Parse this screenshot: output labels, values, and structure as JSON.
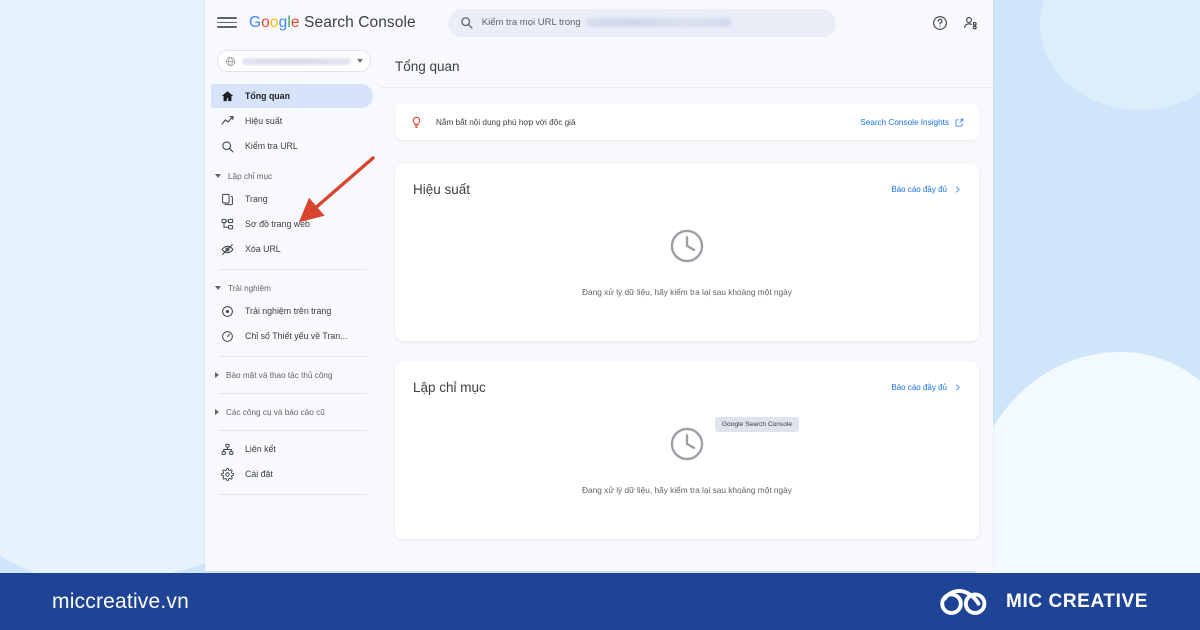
{
  "background": {
    "page_bg_color": "#cfe6fa",
    "blob_color": "#e6f3fd"
  },
  "window": {
    "topbar": {
      "menu_icon": "hamburger-icon",
      "brand": {
        "google": "Google",
        "product": "Search Console"
      },
      "search": {
        "icon": "search-icon",
        "placeholder": "Kiểm tra mọi URL trong",
        "redacted_value": ""
      },
      "help_icon": "help-circle-icon",
      "account_icon": "account-person-icon"
    },
    "sidebar": {
      "property_selector": {
        "icon": "globe-icon",
        "value": "",
        "caret_icon": "chevron-down-icon"
      },
      "items": [
        {
          "label": "Tổng quan",
          "icon": "home-icon",
          "active": true
        },
        {
          "label": "Hiệu suất",
          "icon": "performance-trend-icon",
          "active": false
        },
        {
          "label": "Kiểm tra URL",
          "icon": "search-icon",
          "active": false
        }
      ],
      "sections": [
        {
          "label": "Lập chỉ mục",
          "expanded": true,
          "items": [
            {
              "label": "Trang",
              "icon": "pages-icon"
            },
            {
              "label": "Sơ đồ trang web",
              "icon": "sitemap-icon"
            },
            {
              "label": "Xóa URL",
              "icon": "removals-eye-slash-icon"
            }
          ]
        },
        {
          "label": "Trải nghiệm",
          "expanded": true,
          "items": [
            {
              "label": "Trải nghiệm trên trang",
              "icon": "page-experience-icon"
            },
            {
              "label": "Chỉ số Thiết yếu về Tran...",
              "icon": "core-web-vitals-icon"
            }
          ]
        },
        {
          "label": "Bảo mật và thao tác thủ công",
          "expanded": false,
          "items": []
        },
        {
          "label": "Các công cụ và báo cáo cũ",
          "expanded": false,
          "items": []
        }
      ],
      "footer_items": [
        {
          "label": "Liên kết",
          "icon": "links-icon"
        },
        {
          "label": "Cài đặt",
          "icon": "gear-icon"
        }
      ]
    },
    "main": {
      "page_title": "Tổng quan",
      "insight_banner": {
        "icon": "lightbulb-icon",
        "text": "Nắm bắt nội dung phù hợp với độc giả",
        "link_label": "Search Console Insights",
        "link_icon": "external-link-icon",
        "link_color": "#1a73e8"
      },
      "cards": [
        {
          "title": "Hiệu suất",
          "link_label": "Báo cáo đầy đủ",
          "link_icon": "chevron-right-icon",
          "empty_icon": "clock-icon",
          "empty_text": "Đang xử lý dữ liệu, hãy kiểm tra lại sau khoảng một ngày",
          "tooltip": null
        },
        {
          "title": "Lập chỉ mục",
          "link_label": "Báo cáo đầy đủ",
          "link_icon": "chevron-right-icon",
          "empty_icon": "clock-icon",
          "empty_text": "Đang xử lý dữ liệu, hãy kiểm tra lại sau khoảng một ngày",
          "tooltip": "Google Search Console"
        }
      ]
    }
  },
  "annotation": {
    "arrow_icon": "red-arrow-icon",
    "arrow_color": "#d9442e",
    "points_at": "Sơ đồ trang web"
  },
  "footer": {
    "url": "miccreative.vn",
    "brand_name": "MIC CREATIVE",
    "logo_icon": "infinity-knot-logo-icon",
    "bg_color": "#1f4496"
  }
}
